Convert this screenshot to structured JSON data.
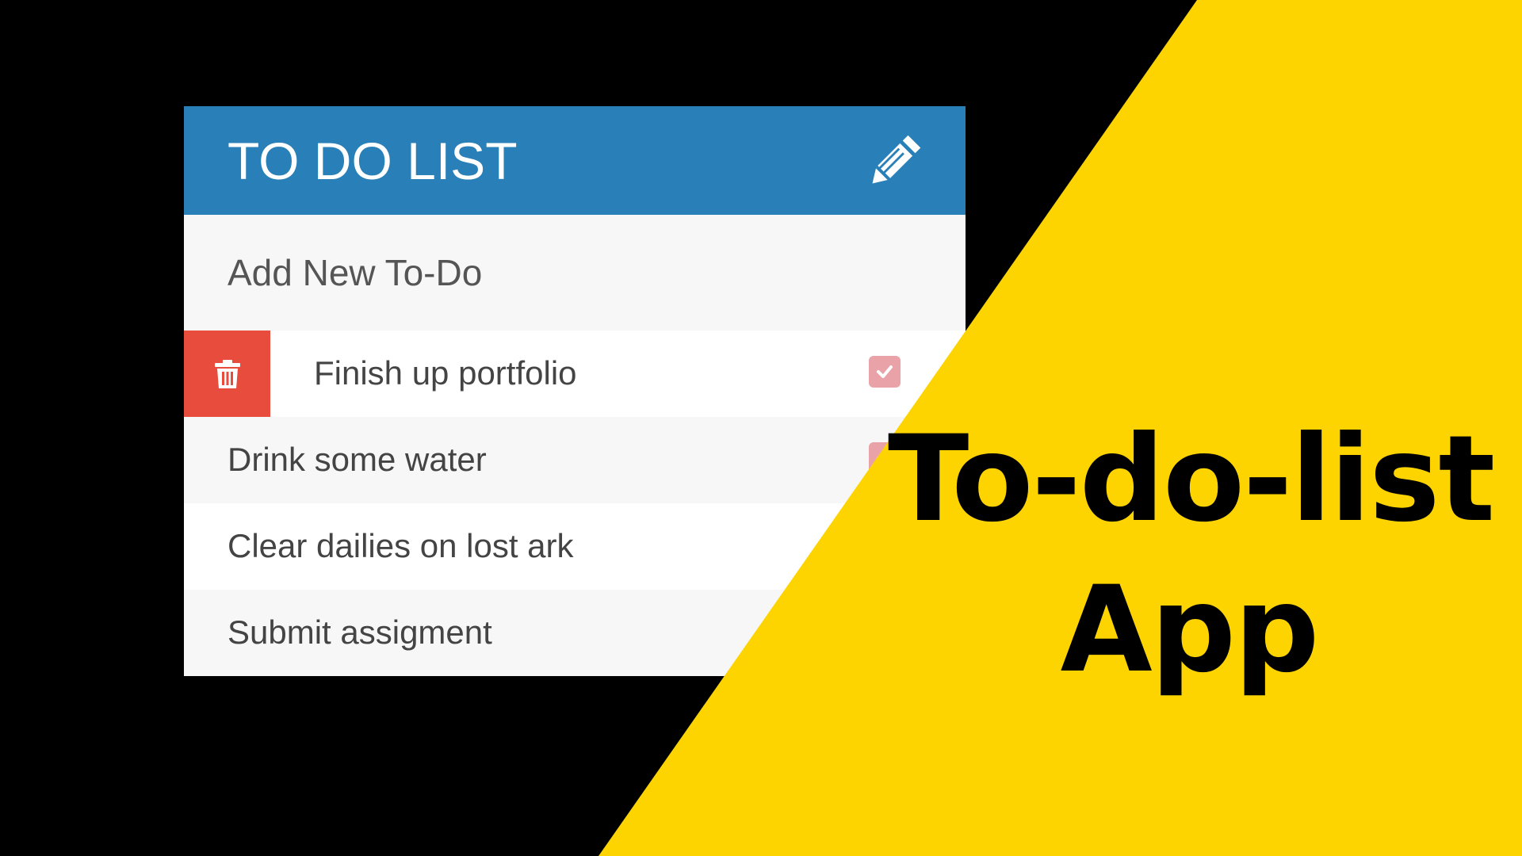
{
  "app": {
    "title": "TO DO LIST",
    "edit_icon": "pencil-icon",
    "add_placeholder": "Add New To-Do",
    "items": [
      {
        "text": "Finish up portfolio",
        "completed": true,
        "delete_icon": "trash-icon",
        "check_icon": "check-icon"
      },
      {
        "text": "Drink some water",
        "completed": true
      },
      {
        "text": "Clear dailies on lost ark",
        "completed": false
      },
      {
        "text": "Submit assigment",
        "completed": false
      }
    ]
  },
  "promo": {
    "line1": "To-do-list",
    "line2": "App"
  },
  "colors": {
    "background": "#000000",
    "accent_yellow": "#fdd400",
    "header_blue": "#2980b9",
    "delete_red": "#e74c3c",
    "checkbox_pink": "#e8a2a8"
  }
}
